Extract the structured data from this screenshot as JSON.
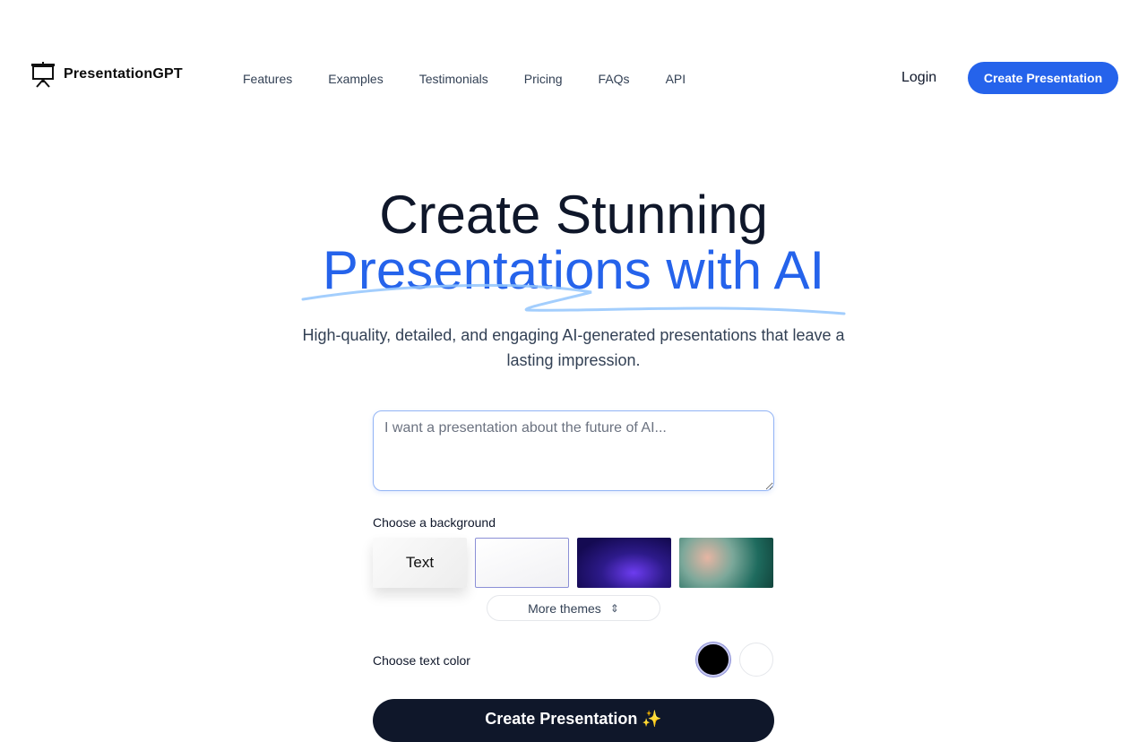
{
  "brand": {
    "name": "PresentationGPT"
  },
  "nav": {
    "links": [
      "Features",
      "Examples",
      "Testimonials",
      "Pricing",
      "FAQs",
      "API"
    ],
    "login": "Login",
    "cta": "Create Presentation"
  },
  "hero": {
    "title_line1": "Create Stunning",
    "title_line2": "Presentations with AI",
    "subtitle": "High-quality, detailed, and engaging AI-generated presentations that leave a lasting impression."
  },
  "form": {
    "prompt_placeholder": "I want a presentation about the future of AI...",
    "background_label": "Choose a background",
    "background_themes": [
      {
        "label": "Text",
        "selected": false
      },
      {
        "label": "",
        "selected": true
      },
      {
        "label": "",
        "selected": false
      },
      {
        "label": "",
        "selected": false
      }
    ],
    "more_themes": "More themes",
    "text_color_label": "Choose text color",
    "text_colors": [
      "#000000",
      "#ffffff"
    ],
    "selected_text_color": "#000000",
    "submit": "Create Presentation ✨"
  },
  "colors": {
    "accent": "#2563eb",
    "dark": "#0f172a"
  }
}
